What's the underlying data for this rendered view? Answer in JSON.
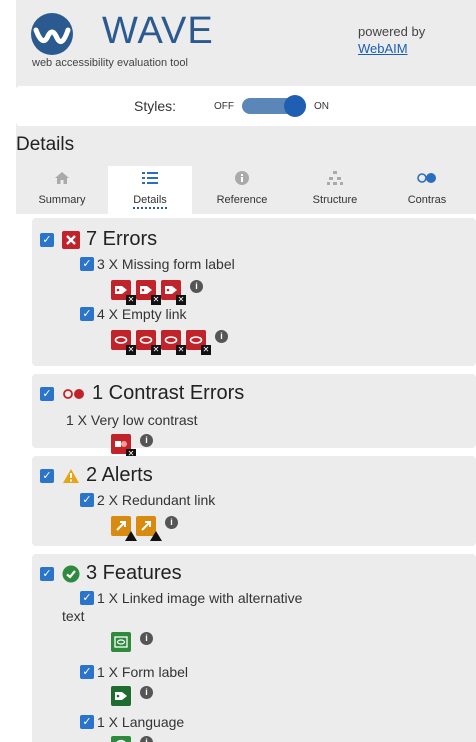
{
  "header": {
    "brand": "WAVE",
    "subtitle": "web accessibility evaluation tool",
    "powered_by": "powered by",
    "powered_link": "WebAIM"
  },
  "styles_bar": {
    "label": "Styles:",
    "off": "OFF",
    "on": "ON",
    "state": "on"
  },
  "details_heading": "Details",
  "tabs": [
    {
      "label": "Summary",
      "icon": "home-icon"
    },
    {
      "label": "Details",
      "icon": "list-icon",
      "active": true
    },
    {
      "label": "Reference",
      "icon": "info-icon"
    },
    {
      "label": "Structure",
      "icon": "structure-icon"
    },
    {
      "label": "Contras",
      "icon": "contrast-icon"
    }
  ],
  "sections": {
    "errors": {
      "title": "7 Errors",
      "items": [
        {
          "label": "3 X Missing form label",
          "count": 3
        },
        {
          "label": "4 X Empty link",
          "count": 4
        }
      ]
    },
    "contrast": {
      "title": "1 Contrast Errors",
      "items": [
        {
          "label": "1 X Very low contrast",
          "count": 1
        }
      ]
    },
    "alerts": {
      "title": "2 Alerts",
      "items": [
        {
          "label": "2 X Redundant link",
          "count": 2
        }
      ]
    },
    "features": {
      "title": "3 Features",
      "items": [
        {
          "label_line1": "1 X Linked image with alternative",
          "label_line2": "text",
          "count": 1
        },
        {
          "label": "1 X Form label",
          "count": 1
        },
        {
          "label": "1 X Language",
          "count": 1
        }
      ]
    }
  },
  "colors": {
    "brand": "#2a5a8f",
    "error": "#c0232a",
    "alert": "#e8a317",
    "feature": "#2e8b3e",
    "checkbox": "#2a74c9"
  }
}
